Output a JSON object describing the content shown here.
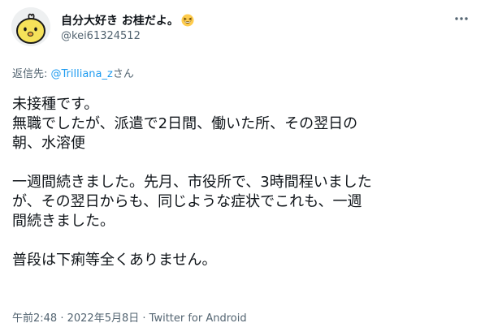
{
  "author": {
    "display_name": "自分大好き お桂だよ。",
    "handle": "@kei61324512",
    "avatar_icon": "chick-avatar",
    "name_emoji": "grinning-squinting-face"
  },
  "reply_context": {
    "prefix": "返信先: ",
    "mention": "@Trilliana_z",
    "suffix": "さん"
  },
  "tweet_body": {
    "line1": "未接種です。",
    "line2": "無職でしたが、派遣で2日間、働いた所、その翌日の",
    "line3": "朝、水溶便",
    "line4": "一週間続きました。先月、市役所で、3時間程いました",
    "line5": "が、その翌日からも、同じような症状でこれも、一週",
    "line6": "間続きました。",
    "line7": "普段は下痢等全くありません。"
  },
  "meta": {
    "time": "午前2:48",
    "separator1": " · ",
    "date": "2022年5月8日",
    "separator2": " · ",
    "source": "Twitter for Android"
  },
  "colors": {
    "text": "#0f1419",
    "secondary": "#536471",
    "link": "#1d9bf0"
  }
}
